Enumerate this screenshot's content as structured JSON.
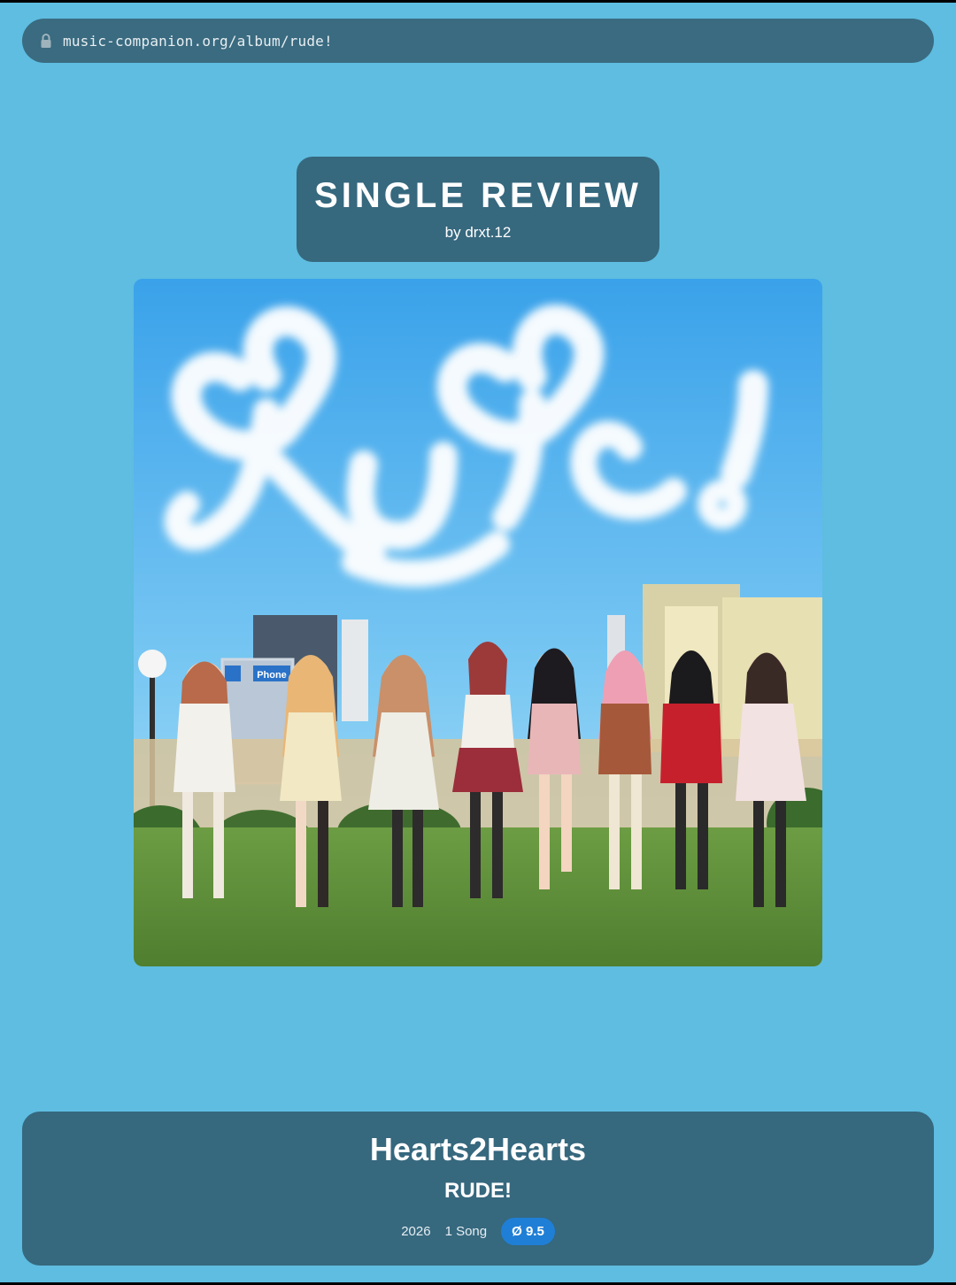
{
  "browser": {
    "url": "music-companion.org/album/rude!",
    "lock_icon": "lock-icon"
  },
  "header": {
    "title": "SINGLE REVIEW",
    "byline": "by drxt.12"
  },
  "cover": {
    "description_icon": "album-cover-image",
    "sign_text": "Phone",
    "sky_color": "#4fb3f0",
    "grass_color": "#5c8f3a"
  },
  "album": {
    "artist": "Hearts2Hearts",
    "title": "RUDE!",
    "year": "2026",
    "songs": "1 Song",
    "rating": "Ø 9.5"
  },
  "colors": {
    "background": "#5ebde0",
    "card": "#36687e",
    "badge": "#1f7fd6"
  }
}
